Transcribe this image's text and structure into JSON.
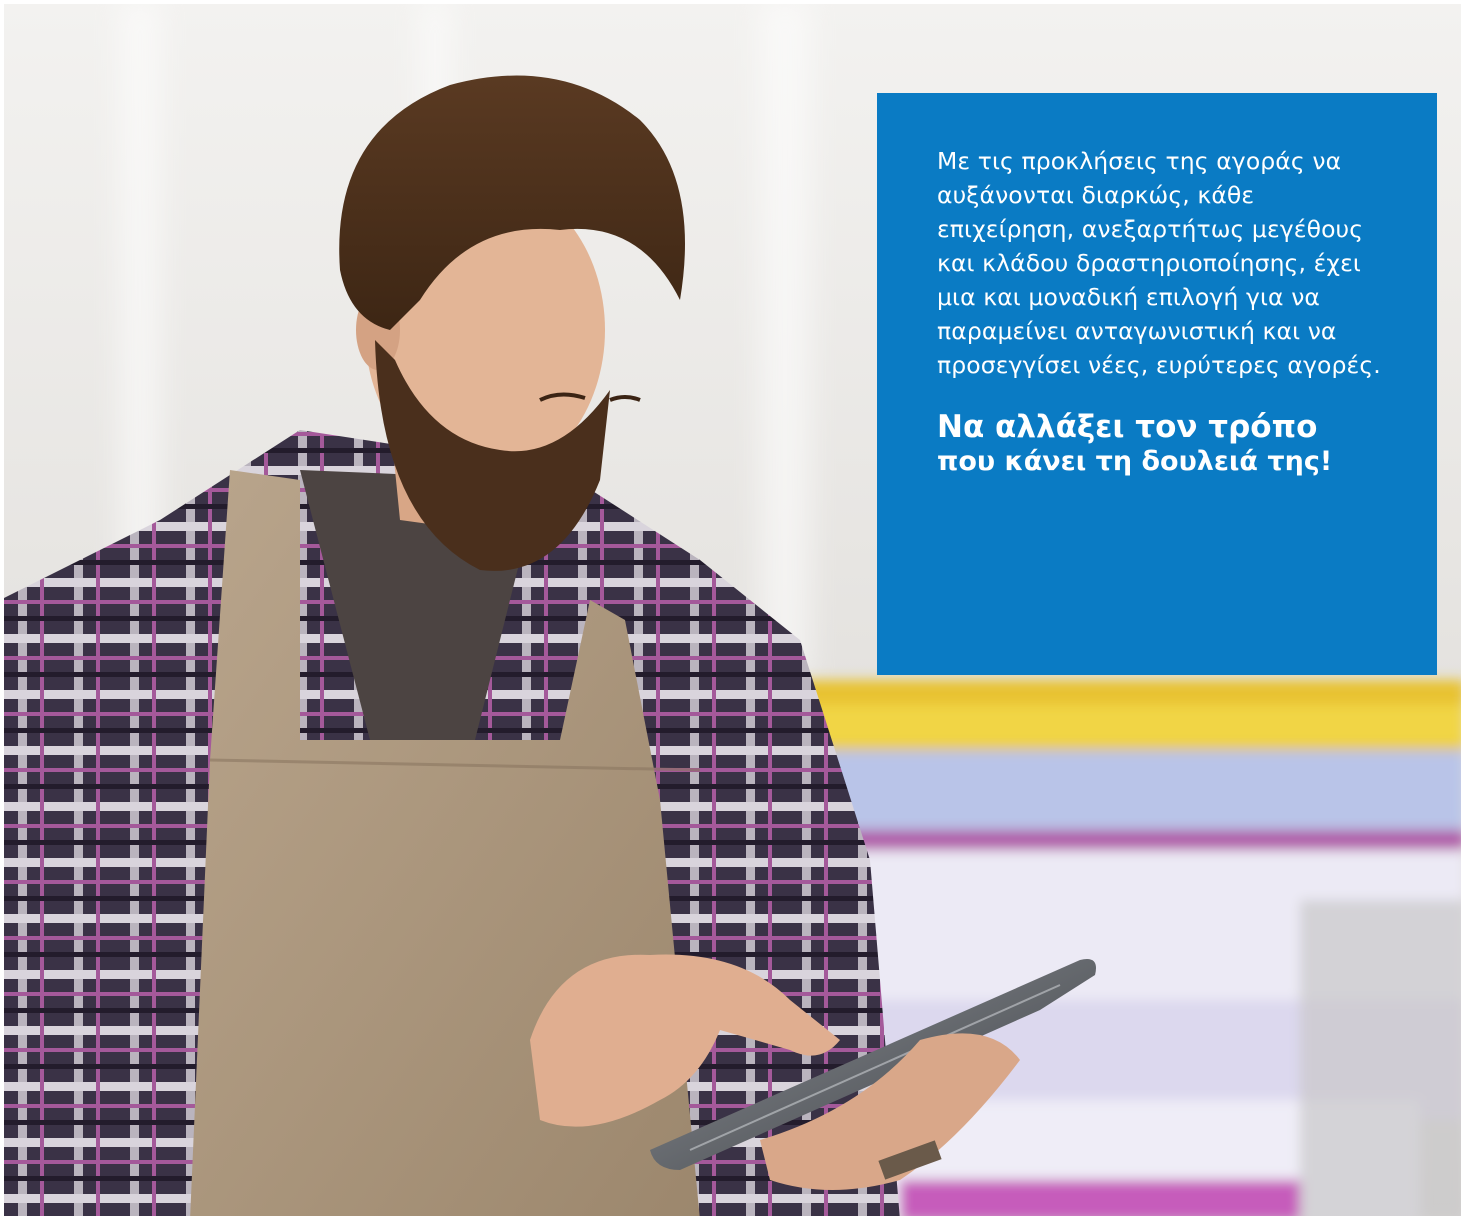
{
  "colors": {
    "card_background": "#0a7bc4",
    "card_text": "#ffffff",
    "background_white": "#f4f3f1"
  },
  "card": {
    "body": "Με τις προκλήσεις της αγοράς να αυξάνονται διαρκώς, κάθε επιχείρηση, ανεξαρτήτως μεγέθους και κλάδου δραστηριοποίησης, έχει μια και μοναδική επιλογή για να παραμείνει ανταγωνιστική και να προσεγγίσει νέες, ευρύτερες αγορές.",
    "headline_line1": "Να αλλάξει τον τρόπο",
    "headline_line2": "που κάνει τη δουλειά της!"
  }
}
